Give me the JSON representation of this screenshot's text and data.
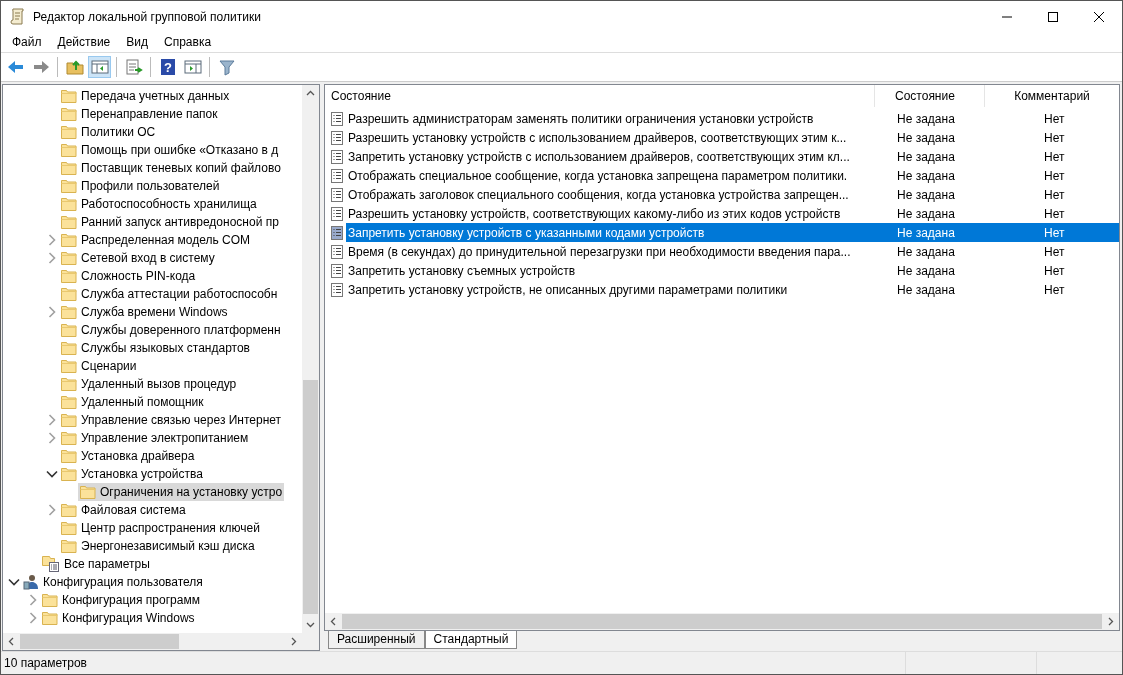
{
  "window": {
    "title": "Редактор локальной групповой политики"
  },
  "menu": [
    "Файл",
    "Действие",
    "Вид",
    "Справка"
  ],
  "toolbar": [
    {
      "kind": "back",
      "disabled": false,
      "pressed": false
    },
    {
      "kind": "forward",
      "disabled": true,
      "pressed": false
    },
    {
      "kind": "sep"
    },
    {
      "kind": "up",
      "pressed": false
    },
    {
      "kind": "tree",
      "pressed": true
    },
    {
      "kind": "sep"
    },
    {
      "kind": "export",
      "pressed": false
    },
    {
      "kind": "sep"
    },
    {
      "kind": "help",
      "glyph": "?",
      "pressed": false
    },
    {
      "kind": "pane",
      "pressed": false
    },
    {
      "kind": "sep"
    },
    {
      "kind": "filter",
      "pressed": false
    }
  ],
  "tree": {
    "items": [
      {
        "kind": "hidden",
        "children": [
          {
            "kind": "hidden",
            "children": [
              {
                "kind": "folder",
                "label": "Передача учетных данных",
                "selected": false
              },
              {
                "kind": "folder",
                "label": "Перенаправление папок",
                "selected": false
              },
              {
                "kind": "folder",
                "label": "Политики ОС",
                "selected": false
              },
              {
                "kind": "folder",
                "label": "Помощь при ошибке «Отказано в д",
                "selected": false
              },
              {
                "kind": "folder",
                "label": "Поставщик теневых копий файлово",
                "selected": false
              },
              {
                "kind": "folder",
                "label": "Профили пользователей",
                "selected": false
              },
              {
                "kind": "folder",
                "label": "Работоспособность хранилища",
                "selected": false
              },
              {
                "kind": "folder",
                "label": "Ранний запуск антивредоносной пр",
                "selected": false
              },
              {
                "kind": "folder",
                "label": "Распределенная модель COM",
                "expanded": false,
                "selected": false
              },
              {
                "kind": "folder",
                "label": "Сетевой вход в систему",
                "expanded": false,
                "selected": false
              },
              {
                "kind": "folder",
                "label": "Сложность PIN-кода",
                "selected": false
              },
              {
                "kind": "folder",
                "label": "Служба аттестации работоспособн",
                "selected": false
              },
              {
                "kind": "folder",
                "label": "Служба времени Windows",
                "expanded": false,
                "selected": false
              },
              {
                "kind": "folder",
                "label": "Службы доверенного платформенн",
                "selected": false
              },
              {
                "kind": "folder",
                "label": "Службы языковых стандартов",
                "selected": false
              },
              {
                "kind": "folder",
                "label": "Сценарии",
                "selected": false
              },
              {
                "kind": "folder",
                "label": "Удаленный вызов процедур",
                "selected": false
              },
              {
                "kind": "folder",
                "label": "Удаленный помощник",
                "selected": false
              },
              {
                "kind": "folder",
                "label": "Управление связью через Интернет",
                "expanded": false,
                "selected": false
              },
              {
                "kind": "folder",
                "label": "Управление электропитанием",
                "expanded": false,
                "selected": false
              },
              {
                "kind": "folder",
                "label": "Установка драйвера",
                "selected": false
              },
              {
                "kind": "folder",
                "label": "Установка устройства",
                "expanded": true,
                "selected": false,
                "children": [
                  {
                    "kind": "folder",
                    "label": "Ограничения на установку устро",
                    "selected": true
                  }
                ]
              },
              {
                "kind": "folder",
                "label": "Файловая система",
                "expanded": false,
                "selected": false
              },
              {
                "kind": "folder",
                "label": "Центр распространения ключей",
                "selected": false
              },
              {
                "kind": "folder",
                "label": "Энергонезависимый кэш диска",
                "selected": false
              }
            ]
          },
          {
            "kind": "settings",
            "label": "Все параметры",
            "selected": false
          }
        ]
      },
      {
        "kind": "user",
        "label": "Конфигурация пользователя",
        "expanded": true,
        "selected": false,
        "children": [
          {
            "kind": "folder",
            "label": "Конфигурация программ",
            "expanded": false,
            "selected": false
          },
          {
            "kind": "folder",
            "label": "Конфигурация Windows",
            "expanded": false,
            "selected": false
          }
        ]
      }
    ]
  },
  "list": {
    "columns": [
      "Состояние",
      "Состояние",
      "Комментарий"
    ],
    "rows": [
      {
        "name": "Разрешить администраторам заменять политики ограничения установки устройств",
        "state": "Не задана",
        "comment": "Нет",
        "selected": false
      },
      {
        "name": "Разрешить установку устройств с использованием драйверов, соответствующих этим к...",
        "state": "Не задана",
        "comment": "Нет",
        "selected": false
      },
      {
        "name": "Запретить установку устройств с использованием драйверов, соответствующих этим кл...",
        "state": "Не задана",
        "comment": "Нет",
        "selected": false
      },
      {
        "name": "Отображать специальное сообщение, когда установка запрещена параметром политики.",
        "state": "Не задана",
        "comment": "Нет",
        "selected": false
      },
      {
        "name": "Отображать заголовок специального сообщения, когда установка устройства запрещен...",
        "state": "Не задана",
        "comment": "Нет",
        "selected": false
      },
      {
        "name": "Разрешить установку устройств, соответствующих какому-либо из этих кодов устройств",
        "state": "Не задана",
        "comment": "Нет",
        "selected": false
      },
      {
        "name": "Запретить установку устройств с указанными кодами устройств",
        "state": "Не задана",
        "comment": "Нет",
        "selected": true
      },
      {
        "name": "Время (в секундах) до принудительной перезагрузки при необходимости введения пара...",
        "state": "Не задана",
        "comment": "Нет",
        "selected": false
      },
      {
        "name": "Запретить установку съемных устройств",
        "state": "Не задана",
        "comment": "Нет",
        "selected": false
      },
      {
        "name": "Запретить установку устройств, не описанных другими параметрами политики",
        "state": "Не задана",
        "comment": "Нет",
        "selected": false
      }
    ]
  },
  "view_tabs": [
    {
      "label": "Расширенный",
      "selected": false
    },
    {
      "label": "Стандартный",
      "selected": true
    }
  ],
  "status_bar": {
    "text": "10 параметров"
  }
}
